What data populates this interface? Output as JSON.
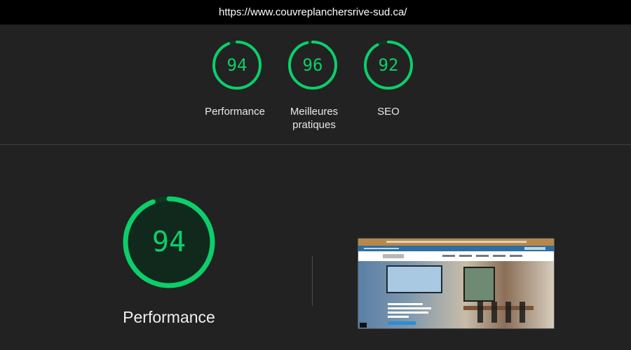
{
  "url_bar": {
    "url": "https://www.couvreplanchersrive-sud.ca/"
  },
  "scores": [
    {
      "value": 94,
      "label": "Performance",
      "fraction": 0.94
    },
    {
      "value": 96,
      "label": "Meilleures\npratiques",
      "fraction": 0.96
    },
    {
      "value": 92,
      "label": "SEO",
      "fraction": 0.92
    }
  ],
  "featured": {
    "value": 94,
    "label": "Performance",
    "fraction": 0.94
  },
  "colors": {
    "pass_green": "#0cce6b",
    "gauge_track": "#0b3a22",
    "background": "#222222"
  }
}
